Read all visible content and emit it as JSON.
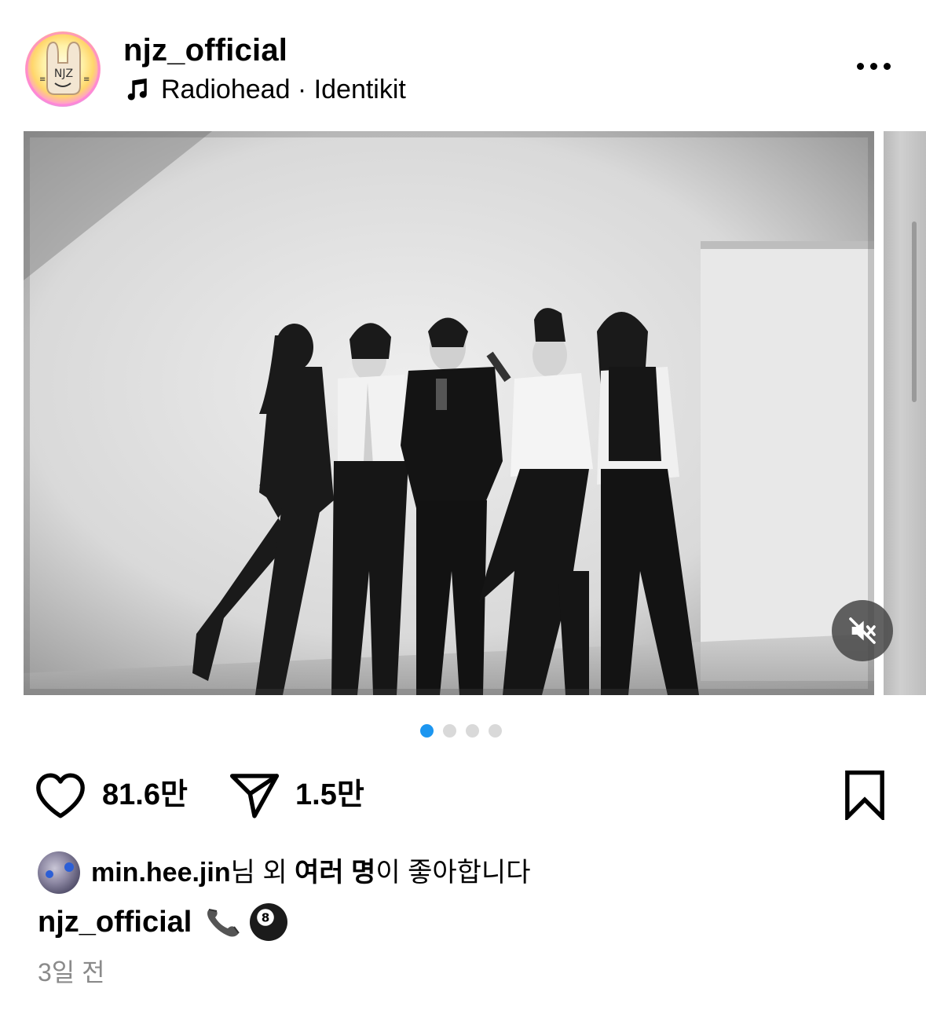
{
  "header": {
    "username": "njz_official",
    "music": "Radiohead · Identikit",
    "avatar_icon": "njz-bunny-logo",
    "more_icon": "more-horizontal-icon"
  },
  "media": {
    "pagination": {
      "total": 4,
      "active": 1
    },
    "mute_icon": "speaker-muted-icon",
    "accent": "#1c96f0"
  },
  "actions": {
    "likes": "81.6만",
    "shares": "1.5만",
    "like_icon": "heart-icon",
    "share_icon": "send-icon",
    "save_icon": "bookmark-icon"
  },
  "likes_line": {
    "liker": "min.hee.jin",
    "text_1": "님 외 ",
    "text_bold": "여러 명",
    "text_2": "이 좋아합니다"
  },
  "caption": {
    "username": "njz_official",
    "emojis": [
      "📞",
      "🎱"
    ]
  },
  "timestamp": "3일 전"
}
